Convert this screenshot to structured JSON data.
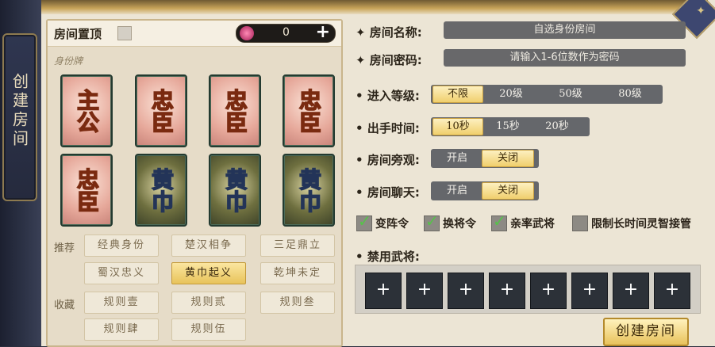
{
  "sidebar": {
    "tab_label": "创建房间"
  },
  "pin": {
    "label": "房间置顶",
    "token_value": "0",
    "token_plus": "+"
  },
  "identity": {
    "section_label": "身份牌",
    "cards": [
      {
        "text": "主公",
        "theme": "red"
      },
      {
        "text": "忠臣",
        "theme": "red"
      },
      {
        "text": "忠臣",
        "theme": "red"
      },
      {
        "text": "忠臣",
        "theme": "red"
      },
      {
        "text": "忠臣",
        "theme": "red"
      },
      {
        "text": "黄巾",
        "theme": "green"
      },
      {
        "text": "黄巾",
        "theme": "green"
      },
      {
        "text": "黄巾",
        "theme": "green"
      }
    ]
  },
  "presets": {
    "recommend_label": "推荐",
    "recommend": [
      "经典身份",
      "楚汉相争",
      "三足鼎立",
      "蜀汉忠义",
      "黄巾起义",
      "乾坤未定"
    ],
    "recommend_active": "黄巾起义",
    "favorite_label": "收藏",
    "favorites": [
      "规则壹",
      "规则贰",
      "规则叁",
      "规则肆",
      "规则伍"
    ]
  },
  "form": {
    "room_name_label": "房间名称:",
    "room_name_value": "自选身份房间",
    "password_label": "房间密码:",
    "password_placeholder": "请输入1-6位数作为密码",
    "level_label": "进入等级:",
    "level_options": [
      "不限",
      "20级",
      "50级",
      "80级"
    ],
    "level_selected": "不限",
    "time_label": "出手时间:",
    "time_options": [
      "10秒",
      "15秒",
      "20秒"
    ],
    "time_selected": "10秒",
    "spectate_label": "房间旁观:",
    "spectate_options": [
      "开启",
      "关闭"
    ],
    "spectate_selected": "关闭",
    "chat_label": "房间聊天:",
    "chat_options": [
      "开启",
      "关闭"
    ],
    "chat_selected": "关闭"
  },
  "options": [
    {
      "label": "变阵令",
      "checked": true
    },
    {
      "label": "换将令",
      "checked": true
    },
    {
      "label": "亲率武将",
      "checked": true
    },
    {
      "label": "限制长时间灵智接管",
      "checked": false
    }
  ],
  "banned": {
    "label": "禁用武将:",
    "slot_symbol": "+",
    "slot_count": 8
  },
  "create_button": "创建房间",
  "colors": {
    "accent_gold": "#e8c35a",
    "check_green": "#57c24a",
    "panel_bg": "#ece5d5"
  }
}
